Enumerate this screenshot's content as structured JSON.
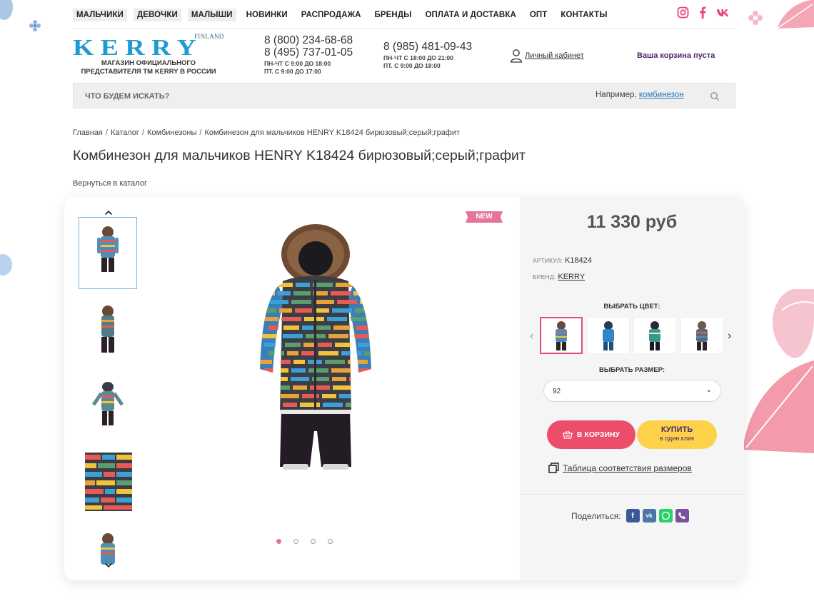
{
  "nav": {
    "items": [
      {
        "label": "МАЛЬЧИКИ",
        "boxed": true
      },
      {
        "label": "ДЕВОЧКИ",
        "boxed": true
      },
      {
        "label": "МАЛЫШИ",
        "boxed": true
      },
      {
        "label": "НОВИНКИ",
        "boxed": false
      },
      {
        "label": "РАСПРОДАЖА",
        "boxed": false
      },
      {
        "label": "БРЕНДЫ",
        "boxed": false
      },
      {
        "label": "ОПЛАТА И ДОСТАВКА",
        "boxed": false
      },
      {
        "label": "ОПТ",
        "boxed": false
      },
      {
        "label": "КОНТАКТЫ",
        "boxed": false
      }
    ],
    "socials": [
      "instagram-icon",
      "facebook-icon",
      "vk-icon"
    ]
  },
  "logo": {
    "finland": "FINLAND",
    "word": "KERRY",
    "sub_line1": "МАГАЗИН ОФИЦИАЛЬНОГО",
    "sub_line2": "ПРЕДСТАВИТЕЛЯ ТМ KERRY В РОССИИ"
  },
  "contacts": {
    "phone1": "8 (800) 234-68-68",
    "phone2": "8 (495) 737-01-05",
    "hours1_a": "ПН-ЧТ С 9:00 ДО 18:00",
    "hours1_b": "ПТ. С 9:00 ДО 17:00",
    "phone3": "8 (985) 481-09-43",
    "hours2_a": "ПН-ЧТ С 18:00 ДО 21:00",
    "hours2_b": "ПТ. С 9:00 ДО 18:00"
  },
  "header": {
    "cabinet": "Личный кабинет",
    "cart": "Ваша корзина пуста"
  },
  "search": {
    "placeholder": "ЧТО БУДЕМ ИСКАТЬ?",
    "hint_prefix": "Например,",
    "hint_link": "комбинезон"
  },
  "breadcrumb": [
    "Главная",
    "Каталог",
    "Комбинезоны",
    "Комбинезон для мальчиков HENRY K18424 бирюзовый;серый;графит"
  ],
  "product": {
    "title": "Комбинезон для мальчиков HENRY K18424 бирюзовый;серый;графит",
    "back": "Вернуться в каталог",
    "badge": "NEW",
    "price": "11 330 руб",
    "article_label": "АРТИКУЛ:",
    "article": "K18424",
    "brand_label": "БРЕНД:",
    "brand": "KERRY",
    "color_label": "ВЫБРАТЬ ЦВЕТ:",
    "size_label": "ВЫБРАТЬ РАЗМЕР:",
    "size_value": "92",
    "to_cart": "В КОРЗИНУ",
    "one_click_1": "КУПИТЬ",
    "one_click_2": "в один клик",
    "size_table": "Таблица соответствия размеров",
    "share": "Поделиться:",
    "slides_count": 4,
    "active_slide": 1
  },
  "colors": {
    "accent_pink": "#ec4d6a",
    "accent_yellow": "#fdd24a",
    "brand_blue": "#1f9bd1",
    "dark_purple": "#4a2a6b"
  }
}
